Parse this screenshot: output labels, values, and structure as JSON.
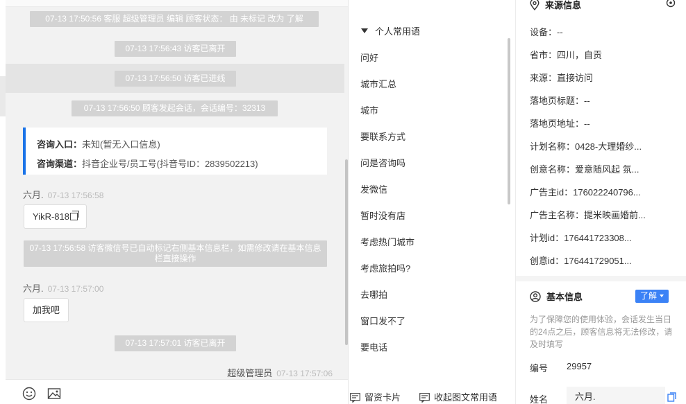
{
  "chat": {
    "messages": {
      "m1": "07-13 17:50:56 客服 超级管理员 编辑 顾客状态： 由 未标记 改为 了解",
      "m2": "07-13 17:56:43 访客已离开",
      "m3": "07-13 17:56:50 访客已进线",
      "m4": "07-13 17:56:50 顾客发起会话，会话编号：32313",
      "m5": "07-13 17:56:58 访客微信号已自动标记右侧基本信息栏，如需修改请在基本信息栏直接操作",
      "m6": "07-13 17:57:01 访客已离开"
    },
    "entry": {
      "entrance_label": "咨询入口：",
      "entrance_value": "未知(暂无入口信息)",
      "channel_label": "咨询渠道：",
      "channel_value": "抖音企业号/员工号(抖音号ID：2839502213)"
    },
    "visitor": {
      "name": "六月.",
      "time1": "07-13 17:56:58",
      "bubble1": "YikR-818",
      "time2": "07-13 17:57:00",
      "bubble2": "加我吧"
    },
    "agent": {
      "name": "超级管理员",
      "time": "07-13 17:57:06"
    }
  },
  "phrases": {
    "header": "个人常用语",
    "items": [
      "问好",
      "城市汇总",
      "城市",
      "要联系方式",
      "问是咨询吗",
      "发微信",
      "暂时没有店",
      "考虑热门城市",
      "考虑旅拍吗?",
      "去哪拍",
      "窗口发不了",
      "要电话"
    ],
    "footer": {
      "card": "留资卡片",
      "collapse": "收起图文常用语"
    }
  },
  "info": {
    "source": {
      "title": "来源信息",
      "rows": [
        "设备：--",
        "省市：四川，自贡",
        "来源：直接访问",
        "落地页标题：--",
        "落地页地址：--",
        "计划名称：0428-大理婚纱...",
        "创意名称：爱意随风起 氛...",
        "广告主id：176022240796...",
        "广告主名称：提米映画婚前...",
        "计划id：176441723308...",
        "创意id：176441729051..."
      ]
    },
    "basic": {
      "title": "基本信息",
      "status": "了解",
      "notice": "为了保障您的使用体验，会话发生当日的24点之后，顾客信息将无法修改，请及时填写",
      "id_label": "编号",
      "id_value": "29957",
      "name_label": "姓名",
      "name_value": "六月."
    }
  },
  "colors": {
    "accent": "#1a73e8",
    "tag": "#3b82f6",
    "system_msg": "#d3d3d3"
  }
}
